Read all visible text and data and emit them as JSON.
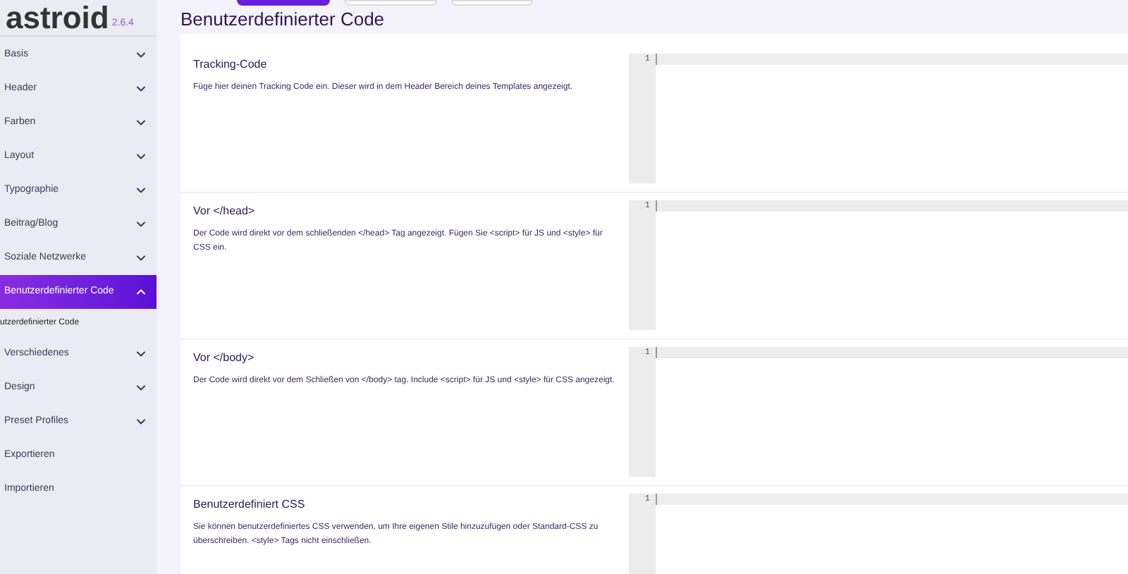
{
  "logo": {
    "name": "astroid",
    "version": "2.6.4"
  },
  "sidebar": {
    "items": [
      {
        "kind": "group",
        "label": "Basis",
        "expanded": false,
        "selected": false
      },
      {
        "kind": "group",
        "label": "Header",
        "expanded": false,
        "selected": false
      },
      {
        "kind": "group",
        "label": "Farben",
        "expanded": false,
        "selected": false
      },
      {
        "kind": "group",
        "label": "Layout",
        "expanded": false,
        "selected": false
      },
      {
        "kind": "group",
        "label": "Typographie",
        "expanded": false,
        "selected": false
      },
      {
        "kind": "group",
        "label": "Beitrag/Blog",
        "expanded": false,
        "selected": false
      },
      {
        "kind": "group",
        "label": "Soziale Netzwerke",
        "expanded": false,
        "selected": false
      },
      {
        "kind": "group",
        "label": "Benutzerdefinierter Code",
        "expanded": true,
        "selected": true,
        "children": [
          {
            "label": "utzerdefinierter Code"
          }
        ]
      },
      {
        "kind": "group",
        "label": "Verschiedenes",
        "expanded": false,
        "selected": false
      },
      {
        "kind": "group",
        "label": "Design",
        "expanded": false,
        "selected": false
      },
      {
        "kind": "group",
        "label": "Preset Profiles",
        "expanded": false,
        "selected": false
      },
      {
        "kind": "link",
        "label": "Exportieren",
        "selected": false
      },
      {
        "kind": "link",
        "label": "Importieren",
        "selected": false
      }
    ]
  },
  "page_title": "Benutzerdefinierter Code",
  "sections": [
    {
      "title": "Tracking-Code",
      "description": "Füge hier deinen Tracking Code ein. Dieser wird in dem Header Bereich deines Templates angezeigt.",
      "line_number": "1"
    },
    {
      "title": "Vor </head>",
      "description": "Der Code wird direkt vor dem schließenden </head> Tag angezeigt. Fügen Sie <script> für JS und <style> für CSS ein.",
      "line_number": "1"
    },
    {
      "title": "Vor </body>",
      "description": "Der Code wird direkt vor dem Schließen von </body> tag. Include <script> für JS und <style> für CSS angezeigt.",
      "line_number": "1"
    },
    {
      "title": "Benutzerdefiniert CSS",
      "description": "Sie können benutzerdefiniertes CSS verwenden, um Ihre eigenen Stile hinzuzufügen oder Standard-CSS zu überschreiben. <style> Tags nicht einschließen.",
      "line_number": "1"
    }
  ]
}
